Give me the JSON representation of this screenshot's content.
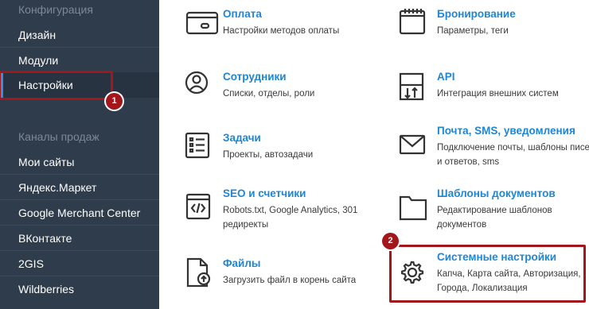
{
  "sidebar": {
    "config_header": "Конфигурация",
    "config_items": [
      {
        "label": "Дизайн"
      },
      {
        "label": "Модули"
      },
      {
        "label": "Настройки"
      }
    ],
    "sales_header": "Каналы продаж",
    "sales_items": [
      {
        "label": "Мои сайты"
      },
      {
        "label": "Яндекс.Маркет"
      },
      {
        "label": "Google Merchant Center"
      },
      {
        "label": "ВКонтакте"
      },
      {
        "label": "2GIS"
      },
      {
        "label": "Wildberries"
      }
    ]
  },
  "settings": {
    "left": [
      {
        "title": "Оплата",
        "desc": "Настройки методов оплаты",
        "icon": "payment-card-icon"
      },
      {
        "title": "Сотрудники",
        "desc": "Списки, отделы, роли",
        "icon": "user-icon"
      },
      {
        "title": "Задачи",
        "desc": "Проекты, автозадачи",
        "icon": "checklist-icon"
      },
      {
        "title": "SEO и счетчики",
        "desc": "Robots.txt, Google Analytics, 301 редиректы",
        "icon": "code-icon"
      },
      {
        "title": "Файлы",
        "desc": "Загрузить файл в корень сайта",
        "icon": "file-upload-icon"
      }
    ],
    "right": [
      {
        "title": "Бронирование",
        "desc": "Параметры, теги",
        "icon": "calendar-icon"
      },
      {
        "title": "API",
        "desc": "Интеграция внешних систем",
        "icon": "api-icon"
      },
      {
        "title": "Почта, SMS, уведомления",
        "desc": "Подключение почты, шаблоны писем и ответов, sms",
        "icon": "mail-icon"
      },
      {
        "title": "Шаблоны документов",
        "desc": "Редактирование шаблонов документов",
        "icon": "folder-icon"
      },
      {
        "title": "Системные настройки",
        "desc": "Капча, Карта сайта, Авторизация, Города, Локализация",
        "icon": "gear-icon"
      }
    ]
  },
  "annotations": {
    "badge_1": "1",
    "badge_2": "2",
    "color": "#a3161b"
  }
}
